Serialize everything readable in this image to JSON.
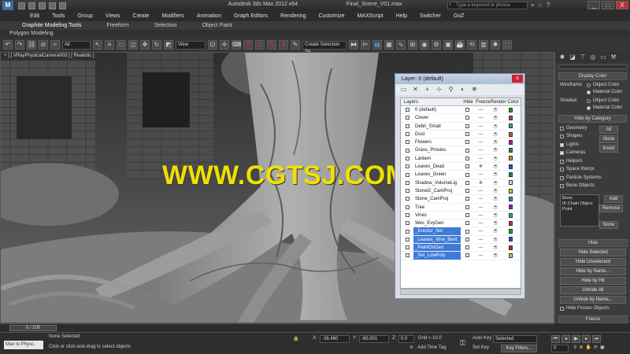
{
  "window": {
    "app_title": "Autodesk 3ds Max  2012 x64",
    "file_title": "Final_Scene_V01.max",
    "search_placeholder": "Type a keyword or phrase",
    "controls": [
      "_",
      "□",
      "X"
    ]
  },
  "menu": [
    "Edit",
    "Tools",
    "Group",
    "Views",
    "Create",
    "Modifiers",
    "Animation",
    "Graph Editors",
    "Rendering",
    "Customize",
    "MAXScript",
    "Help",
    "Switcher",
    "GoZ"
  ],
  "ribbon": {
    "tabs": [
      "Graphite Modeling Tools",
      "Freeform",
      "Selection",
      "Object Paint"
    ],
    "panel_label": "Polygon Modeling"
  },
  "toolbar": {
    "filter_select": "All",
    "view_select": "View",
    "selection_set": "Create Selection Se"
  },
  "viewport": {
    "label": "+ ] [ VRayPhysicalCamera003 ] [ Realistic ]",
    "watermark": "WWW.CGTSJ.COM"
  },
  "layer_dialog": {
    "title": "Layer: 0 (default)",
    "close": "x",
    "headers": [
      "Layers",
      "Hide",
      "Freeze",
      "Render",
      "Color"
    ],
    "layers": [
      {
        "name": "0 (default)",
        "selected": false,
        "color": "#2a9c2a",
        "frozen": false
      },
      {
        "name": "Clover",
        "selected": false,
        "color": "#c83c3c",
        "frozen": false
      },
      {
        "name": "Debri_Small",
        "selected": false,
        "color": "#2aa8a8",
        "frozen": false
      },
      {
        "name": "Dust",
        "selected": false,
        "color": "#cf5b18",
        "frozen": false
      },
      {
        "name": "Flowers",
        "selected": false,
        "color": "#c01f7c",
        "frozen": false
      },
      {
        "name": "Grass_Proxies",
        "selected": false,
        "color": "#3c8a2a",
        "frozen": false
      },
      {
        "name": "Lantern",
        "selected": false,
        "color": "#c8a01e",
        "frozen": false
      },
      {
        "name": "Leaves_Dead",
        "selected": false,
        "color": "#2b4fb8",
        "frozen": false
      },
      {
        "name": "Leaves_Green",
        "selected": false,
        "color": "#1e8c50",
        "frozen": false
      },
      {
        "name": "Shadow_VolumeLig",
        "selected": false,
        "color": "#d9d9d9",
        "frozen": false
      },
      {
        "name": "StoneG_CamProj",
        "selected": false,
        "color": "#d6c83a",
        "frozen": false
      },
      {
        "name": "Stone_CamProj",
        "selected": false,
        "color": "#3a8ac8",
        "frozen": false
      },
      {
        "name": "Tree",
        "selected": false,
        "color": "#8c2ab8",
        "frozen": false
      },
      {
        "name": "Vines",
        "selected": false,
        "color": "#2ab86c",
        "frozen": false
      },
      {
        "name": "Wes_EvyGen",
        "selected": false,
        "color": "#b83a2a",
        "frozen": false
      },
      {
        "name": "_Erector_Set",
        "selected": true,
        "color": "#1e9c3c",
        "frozen": false
      },
      {
        "name": "_Leaves_Vine_Bent",
        "selected": true,
        "color": "#2a4cb8",
        "frozen": false
      },
      {
        "name": "_PaintOnGeo",
        "selected": true,
        "color": "#b82a2a",
        "frozen": false
      },
      {
        "name": "_Set_LowPoly",
        "selected": true,
        "color": "#c8c83a",
        "frozen": false
      }
    ]
  },
  "command_panel": {
    "display_color_title": "Display Color",
    "wireframe_label": "Wireframe:",
    "shaded_label": "Shaded:",
    "object_color": "Object Color",
    "material_color": "Material Color",
    "hide_by_category_title": "Hide by Category",
    "categories": [
      "Geometry",
      "Shapes",
      "Lights",
      "Cameras",
      "Helpers",
      "Space Warps",
      "Particle Systems",
      "Bone Objects"
    ],
    "cat_buttons": [
      "All",
      "None",
      "Invert"
    ],
    "list_items": [
      "Bone",
      "IK Chain Object",
      "Point"
    ],
    "add_btn": "Add",
    "remove_btn": "Remove",
    "none_btn": "None",
    "hide_title": "Hide",
    "hide_buttons": [
      "Hide Selected",
      "Hide Unselected",
      "Hide by Name...",
      "Hide by Hit",
      "Unhide All",
      "Unhide by Name..."
    ],
    "hide_frozen": "Hide Frozen Objects",
    "freeze_title": "Freeze"
  },
  "status": {
    "timeline": "0 / 100",
    "max_to_physc": "Max to Physc.",
    "selection": "None Selected",
    "prompt": "Click or click-and-drag to select objects",
    "x_label": "X:",
    "x_value": "-26.460",
    "y_label": "Y:",
    "y_value": "-65.001",
    "z_label": "Z:",
    "z_value": "0.0",
    "grid": "Grid = 10.0",
    "add_time_tag": "Add Time Tag",
    "auto_key": "Auto Key",
    "selected_dropdown": "Selected",
    "set_key": "Set Key",
    "key_filters": "Key Filters...",
    "frame": "0"
  }
}
